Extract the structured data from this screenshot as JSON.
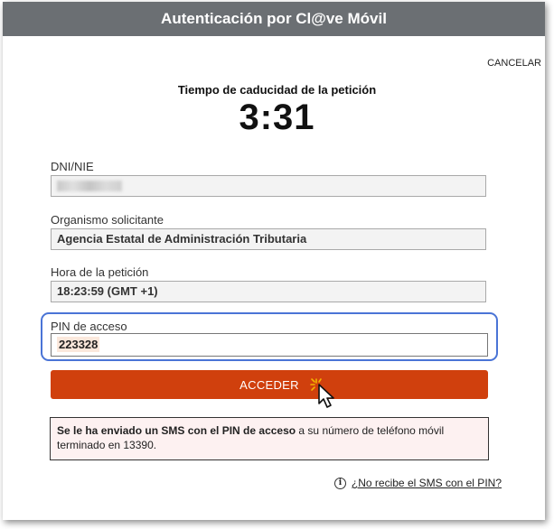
{
  "window": {
    "title": "Autenticación por Cl@ve Móvil",
    "cancel_label": "CANCELAR"
  },
  "timer": {
    "label": "Tiempo de caducidad de la petición",
    "value": "3:31"
  },
  "fields": {
    "dni": {
      "label": "DNI/NIE",
      "value": ""
    },
    "organismo": {
      "label": "Organismo solicitante",
      "value": "Agencia Estatal de Administración Tributaria"
    },
    "hora": {
      "label": "Hora de la petición",
      "value": "18:23:59 (GMT +1)"
    },
    "pin": {
      "label": "PIN de acceso",
      "value": "223328"
    }
  },
  "submit_label": "ACCEDER",
  "notice": {
    "bold": "Se le ha enviado un SMS con el PIN de acceso",
    "rest": " a su número de teléfono móvil terminado en 13390."
  },
  "help": {
    "link_text": "¿No recibe el SMS con el PIN?"
  },
  "colors": {
    "titlebar": "#6b6f73",
    "accent": "#d0400d",
    "focus": "#4a74d6"
  },
  "icons": {
    "info": "info-icon",
    "cursor": "pointer-cursor-icon"
  }
}
